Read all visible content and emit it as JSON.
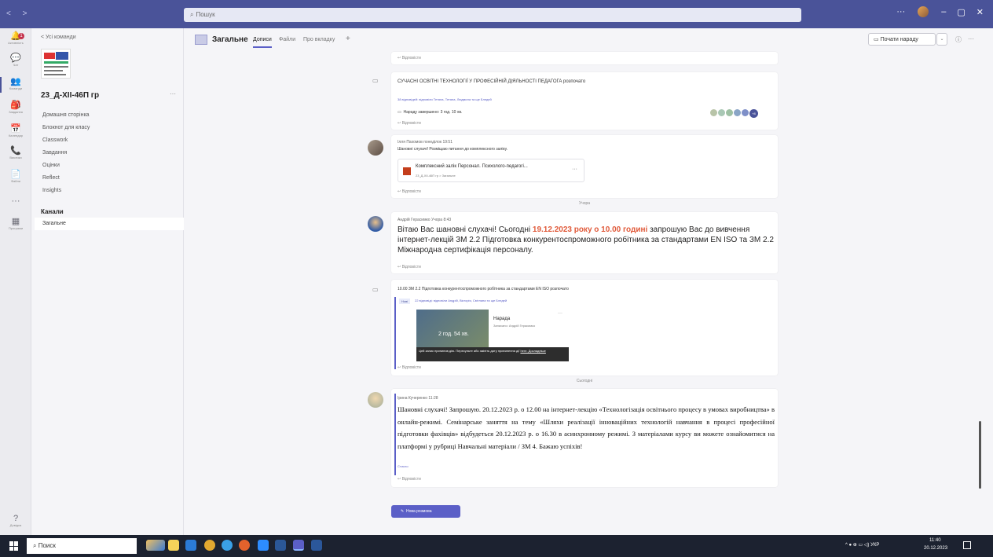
{
  "titlebar": {
    "search_placeholder": "Пошук",
    "nav": "< >",
    "dots": "···",
    "min": "–",
    "max": "▢",
    "close": "✕"
  },
  "rail": {
    "items": [
      {
        "label": "Активність",
        "icon": "bell-icon",
        "glyph": "🔔"
      },
      {
        "label": "Чат",
        "icon": "chat-icon",
        "glyph": "💬"
      },
      {
        "label": "Команди",
        "icon": "teams-icon",
        "glyph": "👥"
      },
      {
        "label": "Завдання",
        "icon": "assignments-icon",
        "glyph": "🎒"
      },
      {
        "label": "Календар",
        "icon": "calendar-icon",
        "glyph": "📅"
      },
      {
        "label": "Виклики",
        "icon": "calls-icon",
        "glyph": "📞"
      },
      {
        "label": "Файли",
        "icon": "files-icon",
        "glyph": "📄"
      },
      {
        "label": "",
        "icon": "more-apps-icon",
        "glyph": "···"
      },
      {
        "label": "Програми",
        "icon": "apps-icon",
        "glyph": "▦"
      },
      {
        "label": "Довідка",
        "icon": "help-icon",
        "glyph": "?"
      }
    ],
    "badge": "1"
  },
  "leftpanel": {
    "back": "< Усі команди",
    "team_name": "23_Д-ХІІ-46П гр",
    "more": "···",
    "items": [
      "Домашня сторінка",
      "Блокнот для класу",
      "Classwork",
      "Завдання",
      "Оцінки",
      "Reflect",
      "Insights"
    ],
    "channels_head": "Канали",
    "channel": "Загальне"
  },
  "header": {
    "title": "Загальне",
    "tabs": [
      "Дописи",
      "Файли",
      "Про вкладку",
      "+"
    ],
    "meet_label": "Почати нараду",
    "drop": "⌄",
    "info": "ⓘ",
    "more": "···"
  },
  "feed": {
    "reply": "↩ Відповісти",
    "msg1": {
      "title": "СУЧАСНІ ОСВІТНІ ТЕХНОЛОГІЇ У ПРОФЕСІЙНІЙ ДІЯЛЬНОСТІ ПЕДАГОГА розпочато",
      "replies": "38 відповідей: відповіли Тетяна, Тетяна, Людмила та ще Бледей",
      "ended": "Нараду завершено: 3 год. 10 хв.",
      "count": "+8"
    },
    "msg2": {
      "author": "Ілля Пахомов  понеділок 19:51",
      "text": "Шановні слухачі! Розміщаю питання до комплексного заліку.",
      "file_name": "Комплексний залік Персонал. Психолого-педагогі...",
      "file_path": "23_Д-ХІІ-46П гр > Загальне",
      "file_more": "···"
    },
    "sep_yesterday": "Учора",
    "msg3": {
      "author": "Андрій Герасимко  Учора 8:43",
      "text_a": "Вітаю Вас шановні слухачі! Сьогодні ",
      "highlight": "19.12.2023 року о 10.00 годині",
      "text_b": " запрошую Вас до вивчення інтернет-лекцій ЗМ 2.2 Підготовка конкурентоспроможного робітника за стандартами EN ISO та ЗМ 2.2 Міжнародна сертифікація персоналу."
    },
    "msg4": {
      "title": "10.00 ЗМ 2.2 Підготовка конкурентоспроможного робітника за стандартами EN ISO розпочато",
      "new_badge": "Нові",
      "replies": "22 відповіді: відповіли Андрій, Вікторія, Світлана та ще Бледей",
      "rec_title": "Нарада",
      "rec_by": "Записано: Андрій Герасимко",
      "rec_duration": "2 год. 54 хв.",
      "rec_more": "···",
      "rec_notice": "Цей запис припинив дію. Пересуньте або змініть дату припинення дії",
      "rec_link": "here. Докладніше"
    },
    "sep_today": "Сьогодні",
    "msg5": {
      "author": "Ірина Кучеренко  11:28",
      "text": "Шановні слухачі! Запрошую. 20.12.2023 р. о 12.00 на інтернет-лекцію «Технологізація освітнього процесу в умовах виробництва» в онлайн-режимі. Семінарське заняття на тему «Шляхи реалізації інноваційних технологій навчання в процесі професійної підготовки фахівців» відбудеться 20.12.2023 р. о 16.30 в асинхронному режимі. З матеріалами курсу ви можете ознайомитися на платформі у рубриці Навчальні матеріали / ЗМ 4. Бажаю успіхів!",
      "see_less": "Стисло"
    },
    "new_conv": "Нова розмова"
  },
  "taskbar": {
    "search": "Поиск",
    "tray": "^ ● ⊕ ▭ ◁) УКР",
    "time": "11:40",
    "date": "20.12.2023"
  },
  "colors": {
    "accent": "#5b5fc7",
    "highlight": "#e05a3a"
  }
}
